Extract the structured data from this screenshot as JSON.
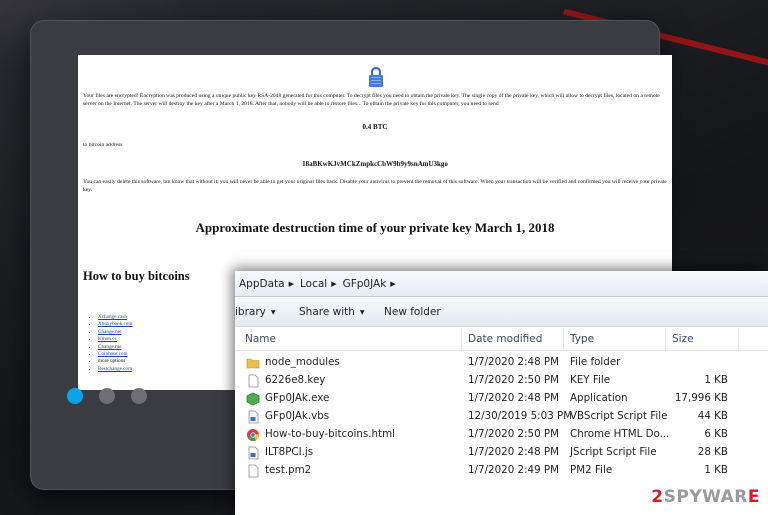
{
  "ransom_note": {
    "para1": "Your files are encrypted! Encryption was produced using a unique public key RSA-2048 generated for this computer. To decrypt files you need to obtain the private key. The single copy of the private key, which will allow to decrypt files, located on a remote server on the Internet. The server will destroy the key after a March 1, 2018. After that, nobody will be able to restore files... To obtain the private key for this computer, you need to send",
    "amount": "0.4 BTC",
    "to_address_label": "to bitcoin address",
    "address": "18aBKwKJvMCkZmpkcCbW9b9y9snAmU3kgo",
    "para2": "You can easily delete this software, but know that without it, you will never be able to get your original files back. Disable your antivirus to prevent the removal of this software. When your transaction will be verified and confirmed you will receive your private key.",
    "destruction": "Approximate destruction time of your private key March 1, 2018",
    "buy_title": "How to buy bitcoins",
    "exchanges": [
      "Xchange.cash",
      "Xbuxybank.com",
      "Change.me",
      "Kmon.cc",
      "Change.me",
      "Coinbase.com",
      "more options",
      "Bestchange.com"
    ]
  },
  "explorer": {
    "breadcrumb": [
      "AppData",
      "Local",
      "GFp0JAk"
    ],
    "toolbar": {
      "library": "ibrary",
      "share": "Share with",
      "new_folder": "New folder"
    },
    "columns": {
      "name": "Name",
      "date": "Date modified",
      "type": "Type",
      "size": "Size"
    },
    "files": [
      {
        "name": "node_modules",
        "date": "1/7/2020 2:48 PM",
        "type": "File folder",
        "size": "",
        "icon": "folder-icon"
      },
      {
        "name": "6226e8.key",
        "date": "1/7/2020 2:50 PM",
        "type": "KEY File",
        "size": "1 KB",
        "icon": "file-icon"
      },
      {
        "name": "GFp0JAk.exe",
        "date": "1/7/2020 2:48 PM",
        "type": "Application",
        "size": "17,996 KB",
        "icon": "exe-icon"
      },
      {
        "name": "GFp0JAk.vbs",
        "date": "12/30/2019 5:03 PM",
        "type": "VBScript Script File",
        "size": "44 KB",
        "icon": "script-icon"
      },
      {
        "name": "How-to-buy-bitcoins.html",
        "date": "1/7/2020 2:50 PM",
        "type": "Chrome HTML Do...",
        "size": "6 KB",
        "icon": "chrome-icon"
      },
      {
        "name": "ILT8PCI.js",
        "date": "1/7/2020 2:48 PM",
        "type": "JScript Script File",
        "size": "28 KB",
        "icon": "script-icon"
      },
      {
        "name": "test.pm2",
        "date": "1/7/2020 2:49 PM",
        "type": "PM2 File",
        "size": "1 KB",
        "icon": "file-icon"
      }
    ]
  },
  "watermark": {
    "num": "2",
    "brand": "SPYWAR",
    "accent": "E"
  },
  "colors": {
    "accent_dot": "#0aa5e8",
    "brand_red": "#d01f2a"
  }
}
